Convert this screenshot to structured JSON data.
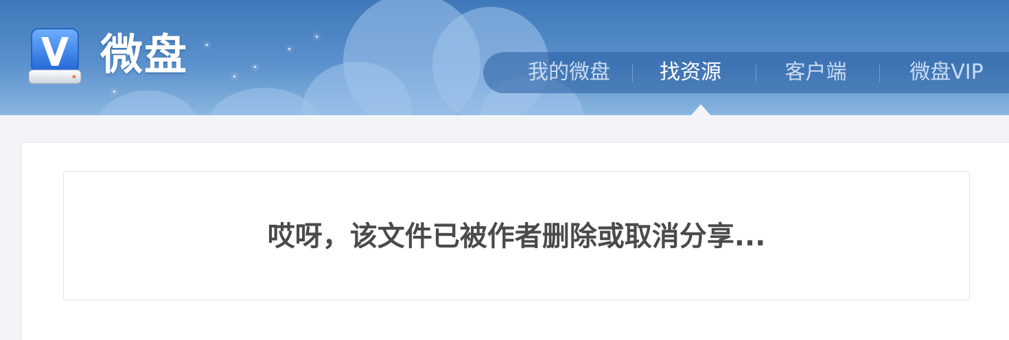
{
  "brand": {
    "name": "微盘",
    "logo_letter": "V"
  },
  "nav": {
    "items": [
      {
        "label": "我的微盘",
        "active": false
      },
      {
        "label": "找资源",
        "active": true
      },
      {
        "label": "客户端",
        "active": false
      },
      {
        "label": "微盘VIP",
        "active": false
      }
    ]
  },
  "main": {
    "message": "哎呀，该文件已被作者删除或取消分享..."
  },
  "colors": {
    "header_blue": "#4a82c3",
    "nav_bar": "#3a70ad",
    "page_bg": "#f3f4f7",
    "message_text": "#4a4a4a"
  }
}
